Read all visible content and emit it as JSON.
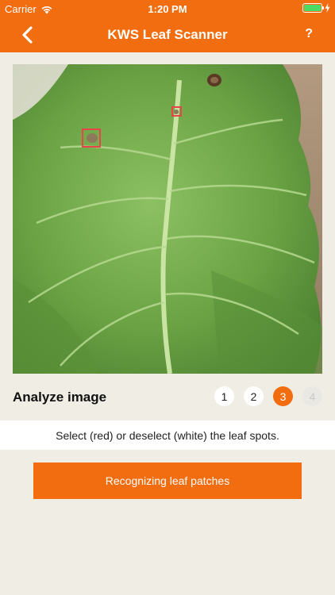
{
  "status_bar": {
    "carrier": "Carrier",
    "time": "1:20 PM",
    "wifi_icon": "wifi-icon",
    "battery_icon": "battery-icon",
    "charging_icon": "bolt-icon"
  },
  "nav": {
    "back_icon": "chevron-left-icon",
    "title": "KWS Leaf Scanner",
    "help_label": "?"
  },
  "image": {
    "description_icon": "leaf-photo"
  },
  "analyze": {
    "title": "Analyze image",
    "steps": [
      "1",
      "2",
      "3",
      "4"
    ],
    "active_step": "3"
  },
  "instruction": "Select (red) or deselect (white) the leaf spots.",
  "action_button": "Recognizing leaf patches",
  "colors": {
    "accent": "#f26d0f",
    "background": "#efede4",
    "selected_spot": "#e8454b"
  }
}
